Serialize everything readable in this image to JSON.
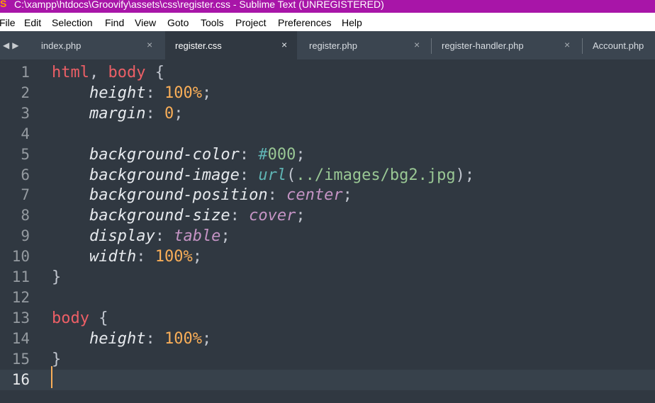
{
  "window": {
    "title": "C:\\xampp\\htdocs\\Groovify\\assets\\css\\register.css - Sublime Text (UNREGISTERED)"
  },
  "menu": [
    "File",
    "Edit",
    "Selection",
    "Find",
    "View",
    "Goto",
    "Tools",
    "Project",
    "Preferences",
    "Help"
  ],
  "tabs": [
    {
      "label": "index.php",
      "active": false
    },
    {
      "label": "register.css",
      "active": true
    },
    {
      "label": "register.php",
      "active": false
    },
    {
      "label": "register-handler.php",
      "active": false
    },
    {
      "label": "Account.php",
      "active": false
    }
  ],
  "icons": {
    "close": "×",
    "nav_back": "◀",
    "nav_forward": "▶",
    "logo": "S"
  },
  "editor": {
    "current_line": 16,
    "lines": [
      {
        "n": "1",
        "tokens": [
          [
            "sel",
            "html"
          ],
          [
            "punc",
            ", "
          ],
          [
            "sel",
            "body"
          ],
          [
            "punc",
            " {"
          ]
        ]
      },
      {
        "n": "2",
        "tokens": [
          [
            "plain",
            "    "
          ],
          [
            "prop",
            "height"
          ],
          [
            "punc",
            ": "
          ],
          [
            "num",
            "100"
          ],
          [
            "unit",
            "%"
          ],
          [
            "punc",
            ";"
          ]
        ]
      },
      {
        "n": "3",
        "tokens": [
          [
            "plain",
            "    "
          ],
          [
            "prop",
            "margin"
          ],
          [
            "punc",
            ": "
          ],
          [
            "num",
            "0"
          ],
          [
            "punc",
            ";"
          ]
        ]
      },
      {
        "n": "4",
        "tokens": []
      },
      {
        "n": "5",
        "tokens": [
          [
            "plain",
            "    "
          ],
          [
            "prop",
            "background-color"
          ],
          [
            "punc",
            ": "
          ],
          [
            "hash",
            "#"
          ],
          [
            "hex",
            "000"
          ],
          [
            "punc",
            ";"
          ]
        ]
      },
      {
        "n": "6",
        "tokens": [
          [
            "plain",
            "    "
          ],
          [
            "prop",
            "background-image"
          ],
          [
            "punc",
            ": "
          ],
          [
            "fn",
            "url"
          ],
          [
            "punc",
            "("
          ],
          [
            "str",
            "../images/bg2.jpg"
          ],
          [
            "punc",
            ");"
          ]
        ]
      },
      {
        "n": "7",
        "tokens": [
          [
            "plain",
            "    "
          ],
          [
            "prop",
            "background-position"
          ],
          [
            "punc",
            ": "
          ],
          [
            "kw",
            "center"
          ],
          [
            "punc",
            ";"
          ]
        ]
      },
      {
        "n": "8",
        "tokens": [
          [
            "plain",
            "    "
          ],
          [
            "prop",
            "background-size"
          ],
          [
            "punc",
            ": "
          ],
          [
            "kw",
            "cover"
          ],
          [
            "punc",
            ";"
          ]
        ]
      },
      {
        "n": "9",
        "tokens": [
          [
            "plain",
            "    "
          ],
          [
            "prop",
            "display"
          ],
          [
            "punc",
            ": "
          ],
          [
            "kw",
            "table"
          ],
          [
            "punc",
            ";"
          ]
        ]
      },
      {
        "n": "10",
        "tokens": [
          [
            "plain",
            "    "
          ],
          [
            "prop",
            "width"
          ],
          [
            "punc",
            ": "
          ],
          [
            "num",
            "100"
          ],
          [
            "unit",
            "%"
          ],
          [
            "punc",
            ";"
          ]
        ]
      },
      {
        "n": "11",
        "tokens": [
          [
            "punc",
            "}"
          ]
        ]
      },
      {
        "n": "12",
        "tokens": []
      },
      {
        "n": "13",
        "tokens": [
          [
            "sel",
            "body"
          ],
          [
            "punc",
            " {"
          ]
        ]
      },
      {
        "n": "14",
        "tokens": [
          [
            "plain",
            "    "
          ],
          [
            "prop",
            "height"
          ],
          [
            "punc",
            ": "
          ],
          [
            "num",
            "100"
          ],
          [
            "unit",
            "%"
          ],
          [
            "punc",
            ";"
          ]
        ]
      },
      {
        "n": "15",
        "tokens": [
          [
            "punc",
            "}"
          ]
        ]
      },
      {
        "n": "16",
        "tokens": []
      }
    ]
  },
  "colors": {
    "title_bar": "#a815a8",
    "editor_bg": "#303841",
    "tab_bar": "#3b4550",
    "selector": "#ec5f66",
    "number": "#f9ae58",
    "keyword": "#c594c5",
    "string": "#99c794",
    "function": "#5fb4b4"
  }
}
